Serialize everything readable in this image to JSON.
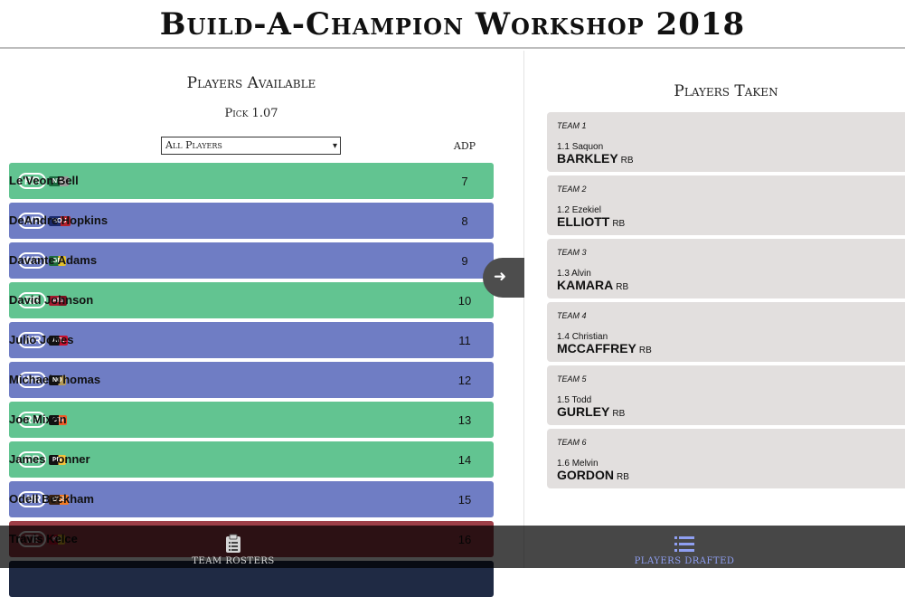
{
  "app_title": "Build-A-Champion Workshop 2018",
  "available": {
    "title": "Players Available",
    "pick_label": "Pick 1.07",
    "filter_value": "All Players",
    "adp_header": "ADP",
    "players": [
      {
        "pos": "RB",
        "team": "NYJ",
        "name": "Le'Veon Bell",
        "adp": "7",
        "team_colors": [
          "#1a6b3f",
          "#9a9a9a"
        ]
      },
      {
        "pos": "WR",
        "team": "HOU",
        "name": "DeAndre Hopkins",
        "adp": "8",
        "team_colors": [
          "#1b2a6b",
          "#b4202c"
        ]
      },
      {
        "pos": "WR",
        "team": "GB",
        "name": "Davante Adams",
        "adp": "9",
        "team_colors": [
          "#1e6b3c",
          "#e4c12d"
        ]
      },
      {
        "pos": "RB",
        "team": "ARI",
        "name": "David Johnson",
        "adp": "10",
        "team_colors": [
          "#a6192e",
          "#7a1220"
        ]
      },
      {
        "pos": "WR",
        "team": "ATL",
        "name": "Julio Jones",
        "adp": "11",
        "team_colors": [
          "#111111",
          "#c8102e"
        ]
      },
      {
        "pos": "WR",
        "team": "NO",
        "name": "Michael Thomas",
        "adp": "12",
        "team_colors": [
          "#111111",
          "#b59a57"
        ]
      },
      {
        "pos": "RB",
        "team": "CIN",
        "name": "Joe Mixon",
        "adp": "13",
        "team_colors": [
          "#111111",
          "#f05a28"
        ]
      },
      {
        "pos": "RB",
        "team": "PIT",
        "name": "James Conner",
        "adp": "14",
        "team_colors": [
          "#111111",
          "#f3c13a"
        ]
      },
      {
        "pos": "WR",
        "team": "CLE",
        "name": "Odell Beckham",
        "adp": "15",
        "team_colors": [
          "#3a2314",
          "#f47a20"
        ]
      },
      {
        "pos": "TE",
        "team": "KC",
        "name": "Travis Kelce",
        "adp": "16",
        "team_colors": [
          "#c8102e",
          "#e4b324"
        ]
      }
    ]
  },
  "taken": {
    "title": "Players Taken",
    "picks": [
      {
        "team": "TEAM 1",
        "pick": "1.1",
        "first": "Saquon",
        "last": "BARKLEY",
        "pos": "RB"
      },
      {
        "team": "TEAM 2",
        "pick": "1.2",
        "first": "Ezekiel",
        "last": "ELLIOTT",
        "pos": "RB"
      },
      {
        "team": "TEAM 3",
        "pick": "1.3",
        "first": "Alvin",
        "last": "KAMARA",
        "pos": "RB"
      },
      {
        "team": "TEAM 4",
        "pick": "1.4",
        "first": "Christian",
        "last": "MCCAFFREY",
        "pos": "RB"
      },
      {
        "team": "TEAM 5",
        "pick": "1.5",
        "first": "Todd",
        "last": "GURLEY",
        "pos": "RB"
      },
      {
        "team": "TEAM 6",
        "pick": "1.6",
        "first": "Melvin",
        "last": "GORDON",
        "pos": "RB"
      }
    ]
  },
  "bottom_nav": {
    "rosters_label": "TEAM ROSTERS",
    "rosters_icon": "clipboard-icon",
    "drafted_label": "PLAYERS DRAFTED",
    "drafted_icon": "list-icon",
    "active": "drafted"
  },
  "colors": {
    "rb_row": "#62c491",
    "wr_row": "#6f7dc4",
    "te_row": "#9d3f48",
    "card_bg": "#e2dfde",
    "active_nav": "#8f9ff2"
  }
}
